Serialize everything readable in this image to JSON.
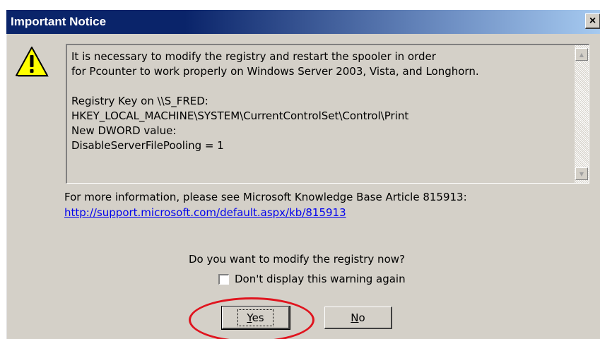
{
  "window": {
    "title": "Important Notice"
  },
  "titlebar": {
    "close_label": "×",
    "close_icon": "close-icon"
  },
  "icon": {
    "name": "warning-icon",
    "color": "#ffff00"
  },
  "message": {
    "text": "It is necessary to modify the registry and restart the spooler in order\nfor Pcounter to work properly on Windows Server 2003, Vista, and Longhorn.\n\nRegistry Key on \\\\S_FRED:\nHKEY_LOCAL_MACHINE\\SYSTEM\\CurrentControlSet\\Control\\Print\nNew DWORD value:\nDisableServerFilePooling = 1",
    "scroll_up_icon": "triangle-up-icon",
    "scroll_down_icon": "triangle-down-icon"
  },
  "info": {
    "text": "For more information, please see Microsoft Knowledge Base Article 815913:",
    "link": "http://support.microsoft.com/default.aspx/kb/815913"
  },
  "question": {
    "text": "Do you want to modify the registry now?"
  },
  "checkbox": {
    "label": "Don't display this warning again",
    "checked": false
  },
  "buttons": {
    "yes": {
      "first": "Y",
      "rest": "es"
    },
    "no": {
      "first": "N",
      "rest": "o"
    }
  },
  "colors": {
    "titlebar_start": "#0a246a",
    "titlebar_end": "#a6caf0",
    "dialog_bg": "#d4d0c8",
    "link": "#0000ee",
    "highlight_oval": "#e0141e"
  }
}
